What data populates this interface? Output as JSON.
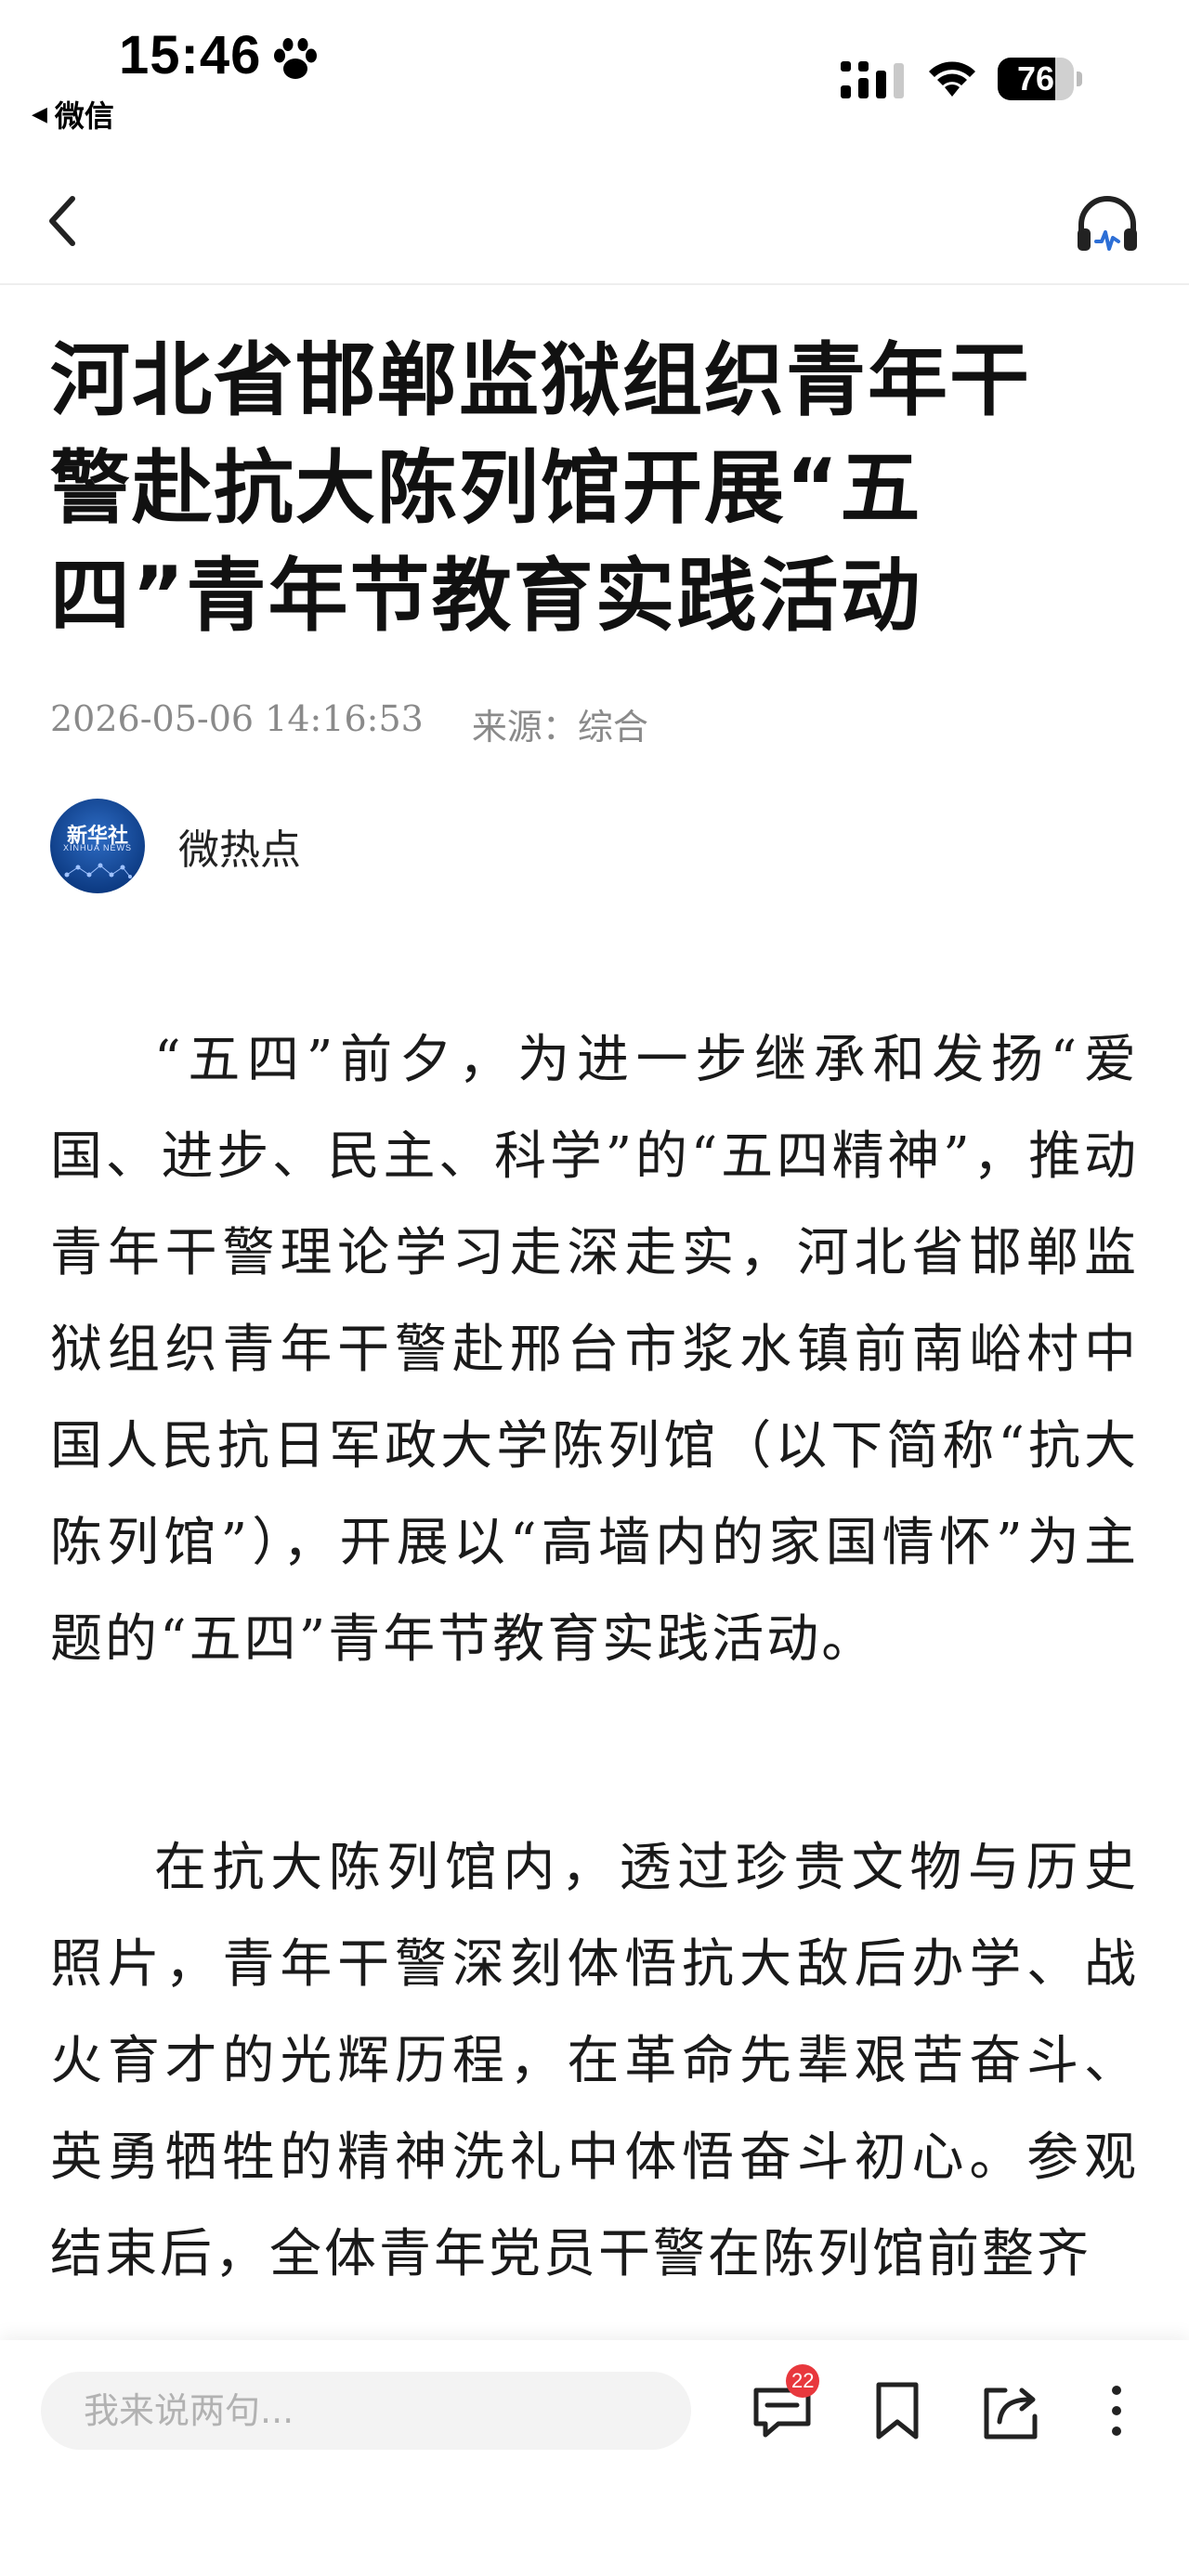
{
  "status_bar": {
    "time": "15:46",
    "back_app": "微信",
    "battery_level": 76,
    "battery_label": "76"
  },
  "icons": {
    "paw": "paw-icon",
    "signal": "cellular-signal-icon",
    "wifi": "wifi-icon",
    "back": "chevron-left-icon",
    "listen": "headphones-icon",
    "comment": "comment-icon",
    "bookmark": "bookmark-icon",
    "share": "share-icon",
    "more": "more-vertical-icon"
  },
  "article": {
    "title": "河北省邯郸监狱组织青年干警赴抗大陈列馆开展“五四”青年节教育实践活动",
    "date": "2026-05-06 14:16:53",
    "source_label": "来源：综合",
    "author": {
      "name": "微热点",
      "logo_cn": "新华社",
      "logo_en": "XINHUA NEWS"
    },
    "paragraphs": [
      "“五四”前夕，为进一步继承和发扬“爱国、进步、民主、科学”的“五四精神”，推动青年干警理论学习走深走实，河北省邯郸监狱组织青年干警赴邢台市浆水镇前南峪村中国人民抗日军政大学陈列馆（以下简称“抗大陈列馆”），开展以“高墙内的家国情怀”为主题的“五四”青年节教育实践活动。",
      "在抗大陈列馆内，透过珍贵文物与历史照片，青年干警深刻体悟抗大敌后办学、战火育才的光辉历程，在革命先辈艰苦奋斗、英勇牺牲的精神洗礼中体悟奋斗初心。参观结束后，全体青年党员干警在陈列馆前整齐"
    ]
  },
  "bottom_bar": {
    "comment_placeholder": "我来说两句...",
    "comment_count": "22"
  },
  "colors": {
    "badge": "#e8383d",
    "meta_text": "#8a8a8a",
    "input_bg": "#f3f3f3"
  }
}
